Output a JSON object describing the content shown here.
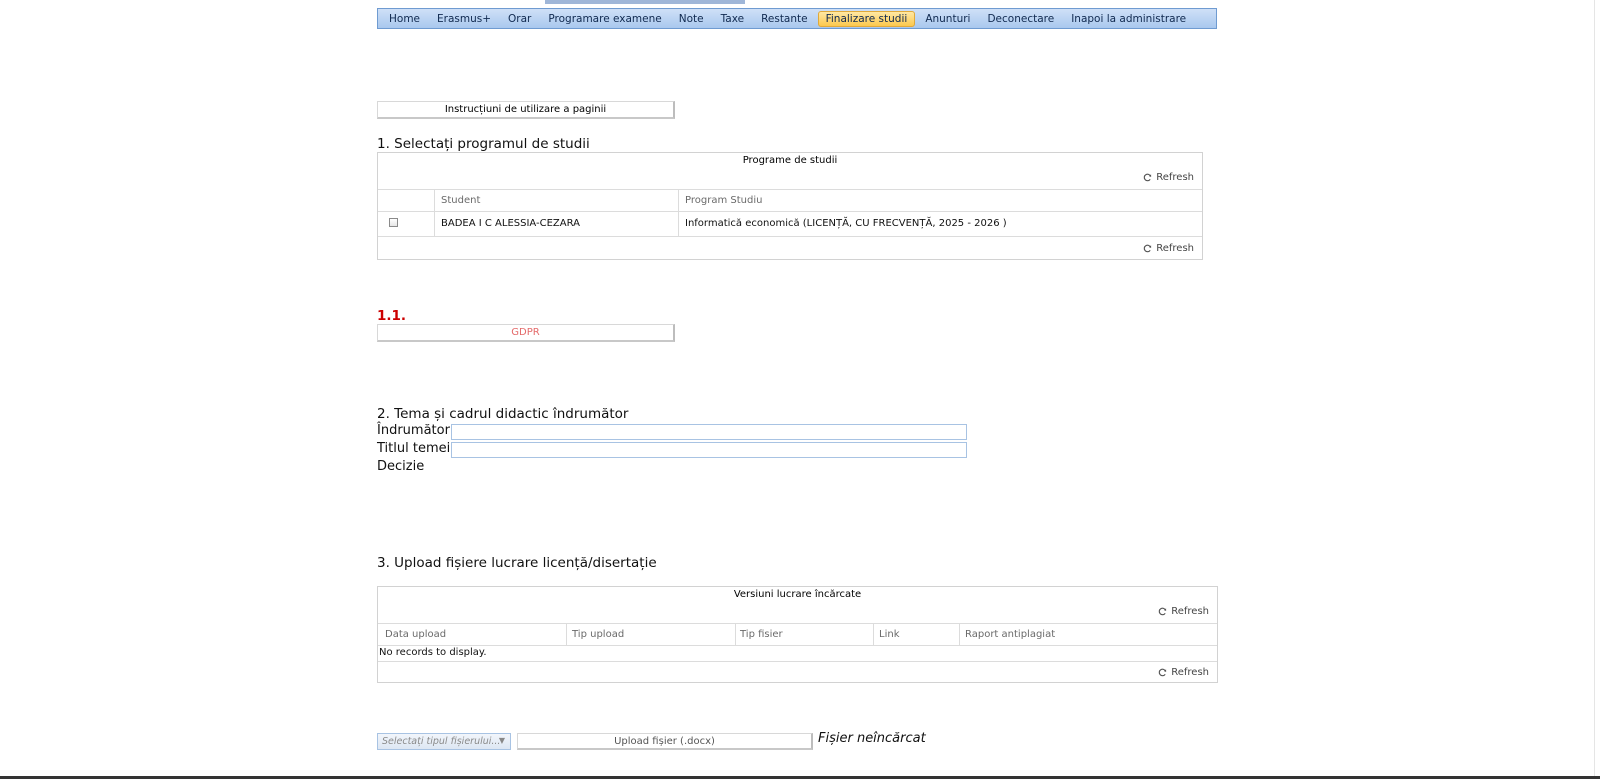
{
  "nav": {
    "items": [
      "Home",
      "Erasmus+",
      "Orar",
      "Programare examene",
      "Note",
      "Taxe",
      "Restante",
      "Finalizare studii",
      "Anunturi",
      "Deconectare",
      "Inapoi la administrare"
    ],
    "active_index": 7
  },
  "instructions_button": "Instrucțiuni de utilizare a paginii",
  "section1": {
    "title": "1. Selectați programul de studii",
    "grid": {
      "caption": "Programe de studii",
      "refresh": "Refresh",
      "columns": [
        "Student",
        "Program Studiu"
      ],
      "rows": [
        {
          "student": "BADEA I C ALESSIA-CEZARA",
          "program": "Informatică economică (LICENȚĂ, CU FRECVENȚĂ, 2025 - 2026 )",
          "checked": false
        }
      ]
    }
  },
  "section11": {
    "number": "1.1.",
    "gdpr_button": "GDPR"
  },
  "section2": {
    "title": "2. Tema și cadrul didactic îndrumător",
    "indrumator_label": "Îndrumător:",
    "indrumator_value": "",
    "titlu_label": "Titlul temei:",
    "titlu_value": "",
    "decizie_label": "Decizie"
  },
  "section3": {
    "title": "3. Upload fișiere lucrare licență/disertație",
    "grid": {
      "caption": "Versiuni lucrare încărcate",
      "refresh": "Refresh",
      "columns": [
        "Data upload",
        "Tip upload",
        "Tip fisier",
        "Link",
        "Raport antiplagiat"
      ],
      "empty_text": "No records to display."
    },
    "select_placeholder": "Selectați tipul fișierului...",
    "upload_button": "Upload fișier (.docx)",
    "upload_status": "Fișier neîncărcat"
  },
  "colors": {
    "nav_bg": "#a9c8ee",
    "nav_active": "#fcc84e",
    "red_number": "#cc0000",
    "gdpr_text": "#e46a6a"
  }
}
